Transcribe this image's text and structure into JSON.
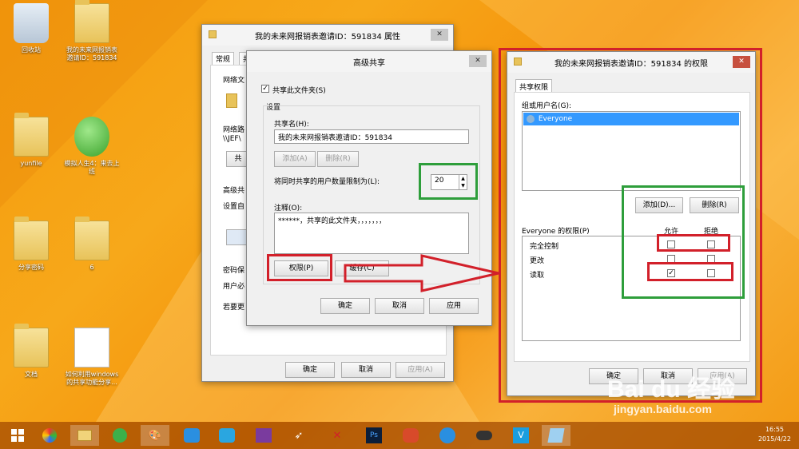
{
  "desktop": {
    "icons": [
      {
        "label": "回收站"
      },
      {
        "label": "我的未来网报销表邀请ID：591834"
      },
      {
        "label": "yunfile"
      },
      {
        "label": "模拟人生4：来去上班"
      },
      {
        "label": "分享密码"
      },
      {
        "label": "6"
      },
      {
        "label": "文档"
      },
      {
        "label": "如何利用windows的共享功能分享..."
      }
    ]
  },
  "props_window": {
    "title": "我的未来网报销表邀请ID：591834 属性",
    "tabs": [
      "常规",
      "共"
    ],
    "partial_labels": [
      "网络文",
      "网络路",
      "\\\\JEF\\",
      "共",
      "高级共",
      "设置自",
      "密码保",
      "用户必",
      "若要更"
    ],
    "buttons": {
      "ok": "确定",
      "cancel": "取消",
      "apply": "应用(A)"
    }
  },
  "adv_window": {
    "title": "高级共享",
    "share_checkbox_label": "共享此文件夹(S)",
    "settings_label": "设置",
    "share_name_label": "共享名(H):",
    "share_name_value": "我的未来网报销表邀请ID：591834",
    "add_button": "添加(A)",
    "remove_button": "删除(R)",
    "limit_label": "将同时共享的用户数量限制为(L):",
    "limit_value": "20",
    "comment_label": "注释(O):",
    "comment_value": "******，共享的此文件夹，，，，，，，",
    "permissions_button": "权限(P)",
    "cache_button": "缓存(C)",
    "ok": "确定",
    "cancel": "取消",
    "apply": "应用"
  },
  "perm_window": {
    "title": "我的未来网报销表邀请ID：591834 的权限",
    "tab": "共享权限",
    "group_label": "组或用户名(G):",
    "users": [
      "Everyone"
    ],
    "add_button": "添加(D)...",
    "remove_button": "删除(R)",
    "perm_header": "Everyone 的权限(P)",
    "allow_header": "允许",
    "deny_header": "拒绝",
    "permissions": [
      {
        "name": "完全控制",
        "allow": false,
        "deny": false
      },
      {
        "name": "更改",
        "allow": false,
        "deny": false
      },
      {
        "name": "读取",
        "allow": true,
        "deny": false
      }
    ],
    "ok": "确定",
    "cancel": "取消",
    "apply": "应用(A)"
  },
  "taskbar": {
    "clock_time": "16:55",
    "clock_date": "2015/4/22"
  },
  "watermark": {
    "brand": "Bai du 经验",
    "url": "jingyan.baidu.com"
  },
  "colors": {
    "highlight_red": "#d2202a",
    "highlight_green": "#2e9e3b",
    "selection": "#3399ff"
  }
}
